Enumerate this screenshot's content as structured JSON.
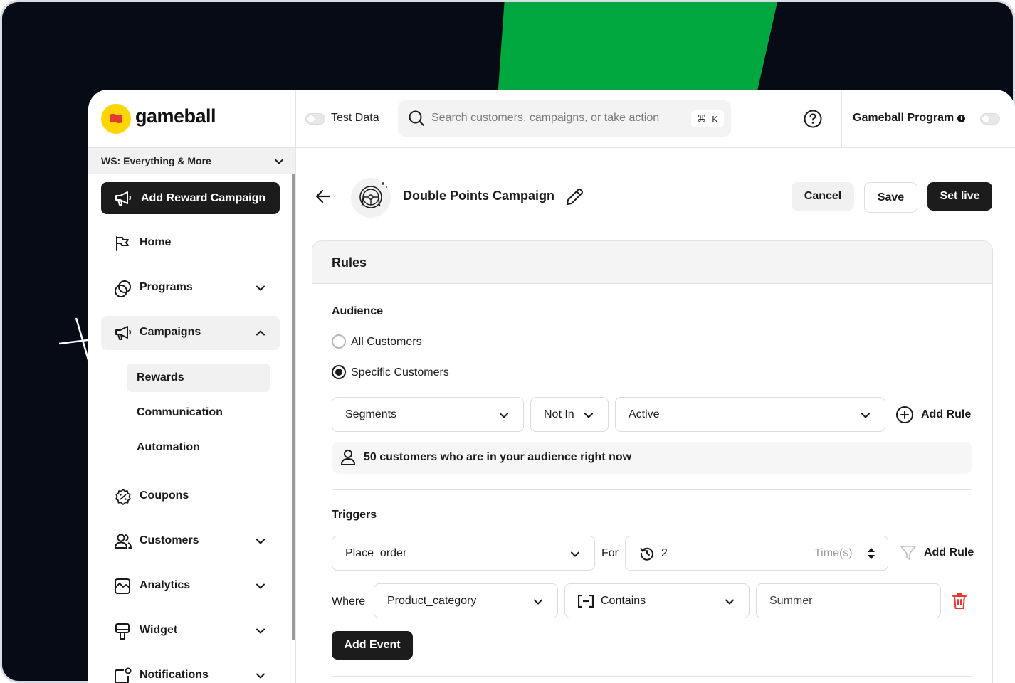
{
  "brand": {
    "name": "gameball",
    "accent_green": "#00a63e",
    "logo_yellow": "#ffd500",
    "logo_red": "#e53935",
    "dark_button": "#1c1c1c",
    "backdrop": "#060b15"
  },
  "header": {
    "test_data_label": "Test Data",
    "search_placeholder": "Search customers, campaigns, or take action",
    "shortcut_cmd": "⌘",
    "shortcut_key": "K",
    "program_label": "Gameball Program"
  },
  "sidebar": {
    "workspace": "WS: Everything & More",
    "primary_button": "Add Reward Campaign",
    "items": [
      {
        "label": "Home",
        "icon": "flag-icon"
      },
      {
        "label": "Programs",
        "icon": "programs-icon"
      },
      {
        "label": "Campaigns",
        "icon": "megaphone-icon"
      },
      {
        "label": "Coupons",
        "icon": "coupon-icon"
      },
      {
        "label": "Customers",
        "icon": "users-icon"
      },
      {
        "label": "Analytics",
        "icon": "analytics-icon"
      },
      {
        "label": "Widget",
        "icon": "widget-icon"
      },
      {
        "label": "Notifications",
        "icon": "notifications-icon"
      }
    ],
    "campaign_subitems": [
      "Rewards",
      "Communication",
      "Automation"
    ]
  },
  "campaign": {
    "title": "Double Points Campaign",
    "cancel_label": "Cancel",
    "save_label": "Save",
    "set_live_label": "Set live"
  },
  "rules": {
    "title": "Rules",
    "audience": {
      "title": "Audience",
      "option_all": "All Customers",
      "option_specific": "Specific Customers",
      "selected": "Specific Customers",
      "segment_field": "Segments",
      "operator": "Not In",
      "segment_value": "Active",
      "add_rule_label": "Add Rule",
      "summary": "50 customers who are in your audience right now"
    },
    "triggers": {
      "title": "Triggers",
      "event": "Place_order",
      "for_label": "For",
      "count": "2",
      "count_unit": "Time(s)",
      "add_rule_label": "Add Rule",
      "where_label": "Where",
      "property": "Product_category",
      "condition": "Contains",
      "value": "Summer",
      "add_event_label": "Add Event"
    }
  }
}
